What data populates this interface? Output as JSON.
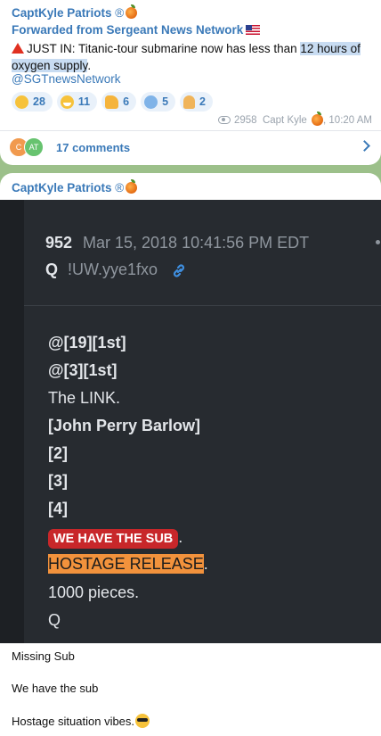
{
  "message1": {
    "sender": "CaptKyle Patriots",
    "sender_mark": "®",
    "forwarded": "Forwarded from Sergeant News Network",
    "text_prefix": "JUST IN: Titanic-tour submarine now has less than ",
    "text_highlight_1": "12 hours of",
    "text_highlight_2": "oxygen supply",
    "text_suffix": ".",
    "mention": "@SGTnewsNetwork",
    "reactions": [
      {
        "icon": "thinking-face-icon",
        "count": "28"
      },
      {
        "icon": "grinning-face-icon",
        "count": "11"
      },
      {
        "icon": "thumbs-up-icon",
        "count": "6"
      },
      {
        "icon": "screaming-face-icon",
        "count": "5"
      },
      {
        "icon": "praying-hands-icon",
        "count": "2"
      }
    ],
    "views": "2958",
    "author": "Capt Kyle",
    "time": ", 10:20 AM",
    "avatars": [
      "C",
      "AT"
    ],
    "comments": "17 comments"
  },
  "message2": {
    "sender": "CaptKyle Patriots",
    "sender_mark": "®",
    "post": {
      "number": "952",
      "date": "Mar 15, 2018 10:41:56 PM EDT",
      "q": "Q",
      "trip": "!UW.yye1fxo",
      "lines": [
        "@[19][1st]",
        "@[3][1st]",
        "The LINK.",
        "[John Perry Barlow]",
        "[2]",
        "[3]",
        "[4]"
      ],
      "red_tag": "WE HAVE THE SUB",
      "red_tag_suffix": ".",
      "orange_tag": "HOSTAGE RELEASE",
      "orange_tag_suffix": ".",
      "pieces": "1000 pieces.",
      "sign": "Q"
    },
    "captions": [
      "Missing Sub",
      "We have the sub",
      "Hostage situation vibes."
    ]
  },
  "colors": {
    "background": "#9cc08a",
    "link": "#3a79b8",
    "screenshot_bg": "#272b30",
    "red_tag": "#c8272a",
    "orange_tag": "#f2923c"
  }
}
